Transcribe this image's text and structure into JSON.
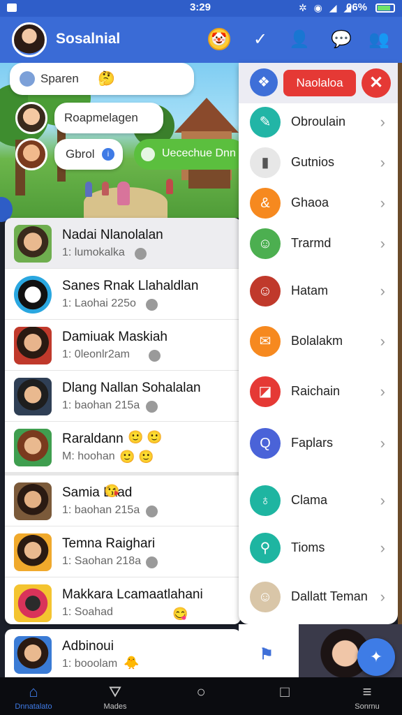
{
  "status_left": {
    "time": "3:29",
    "icons": "⚹ ▮"
  },
  "status_right": {
    "icons": "✲ ◉ ◢ ◢",
    "battery_text": "06%"
  },
  "app": {
    "title": "Sosalnial",
    "header_emoji": "🤡"
  },
  "scene": {
    "bubble_1": {
      "text": "Sparen",
      "emoji": "🤔"
    },
    "bubble_2": {
      "text": "Roapmelagen"
    },
    "bubble_3": {
      "text": "Gbrol",
      "badge": "i"
    },
    "green_chip": {
      "text": "Uecechue Dnn"
    }
  },
  "chats": [
    {
      "name": "Nadai Nlanolalan",
      "preview": "1: lumokalka"
    },
    {
      "name": "Sanes Rnak Llahaldlan",
      "preview": "1: Laohai 225o"
    },
    {
      "name": "Damiuak Maskiah",
      "preview": "1: 0leonlr2am"
    },
    {
      "name": "Dlang Nallan Sohalalan",
      "preview": "1: baohan 215a"
    },
    {
      "name": "Raraldann",
      "preview": "M: hoohan",
      "name_emojis": "🙂 🙂",
      "preview_emojis": "🙂 🙂"
    },
    {
      "name": "Samia Lkad",
      "preview": "1: baohan 215a",
      "name_emoji": "😘"
    },
    {
      "name": "Temna Raighari",
      "preview": "1: Saohan 218a"
    },
    {
      "name": "Makkara Lcamaatlahani",
      "preview": "1: Soahad",
      "preview_emoji": "😋"
    },
    {
      "name": "Adbinoui",
      "preview": "1: booolam",
      "preview_emoji": "🐥"
    }
  ],
  "right_header": {
    "icons": [
      "✓",
      "👤",
      "💬",
      "👥"
    ]
  },
  "menu": {
    "top_label": "Naolaloa",
    "close": "✕",
    "items": [
      {
        "label": "Obroulain",
        "icon": "✎",
        "color": "#22b5a6"
      },
      {
        "label": "Gutnios",
        "icon": "▮",
        "color": "#e7e7e7"
      },
      {
        "label": "Ghaoa",
        "icon": "&",
        "color": "#f6891f"
      },
      {
        "label": "Trarmd",
        "icon": "☺",
        "color": "#4caf50"
      },
      {
        "label": "Hatam",
        "icon": "☺",
        "color": "#c0392b"
      },
      {
        "label": "Bolalakm",
        "icon": "✉",
        "color": "#f6891f"
      },
      {
        "label": "Raichain",
        "icon": "◪",
        "color": "#e53935"
      },
      {
        "label": "Faplars",
        "icon": "Q",
        "color": "#4a63d8"
      },
      {
        "label": "Clama",
        "icon": "♁",
        "color": "#1eb5a1"
      },
      {
        "label": "Tioms",
        "icon": "⚲",
        "color": "#1eb5a1"
      },
      {
        "label": "Dallatt Teman",
        "icon": "☺",
        "color": "#d9c6a8"
      }
    ],
    "chevron": "›"
  },
  "fab_icon": "✦",
  "bottom_nav": [
    {
      "label": "Dnnatalato",
      "icon": "⌂"
    },
    {
      "label": "Mades",
      "icon": "⛛"
    },
    {
      "label": "",
      "icon": "○"
    },
    {
      "label": "",
      "icon": "□"
    },
    {
      "label": "Sonrnu",
      "icon": "≡"
    }
  ]
}
